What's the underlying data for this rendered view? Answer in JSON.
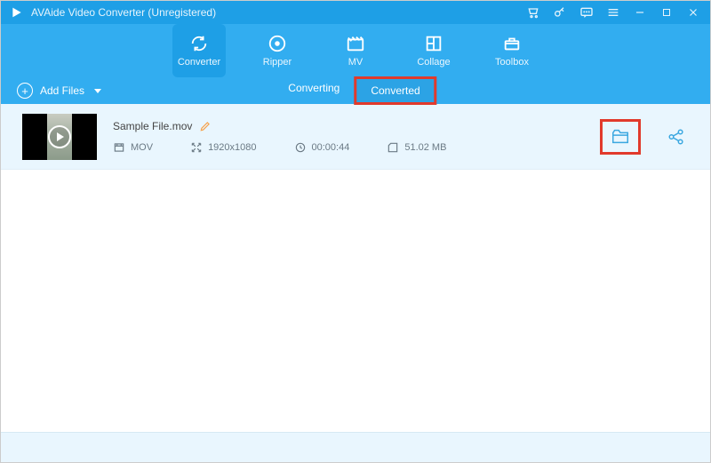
{
  "titlebar": {
    "title": "AVAide Video Converter (Unregistered)"
  },
  "nav": {
    "converter": "Converter",
    "ripper": "Ripper",
    "mv": "MV",
    "collage": "Collage",
    "toolbox": "Toolbox"
  },
  "subbar": {
    "add_files": "Add Files",
    "tab_converting": "Converting",
    "tab_converted": "Converted"
  },
  "file": {
    "name": "Sample File.mov",
    "format": "MOV",
    "resolution": "1920x1080",
    "duration": "00:00:44",
    "size": "51.02 MB"
  }
}
